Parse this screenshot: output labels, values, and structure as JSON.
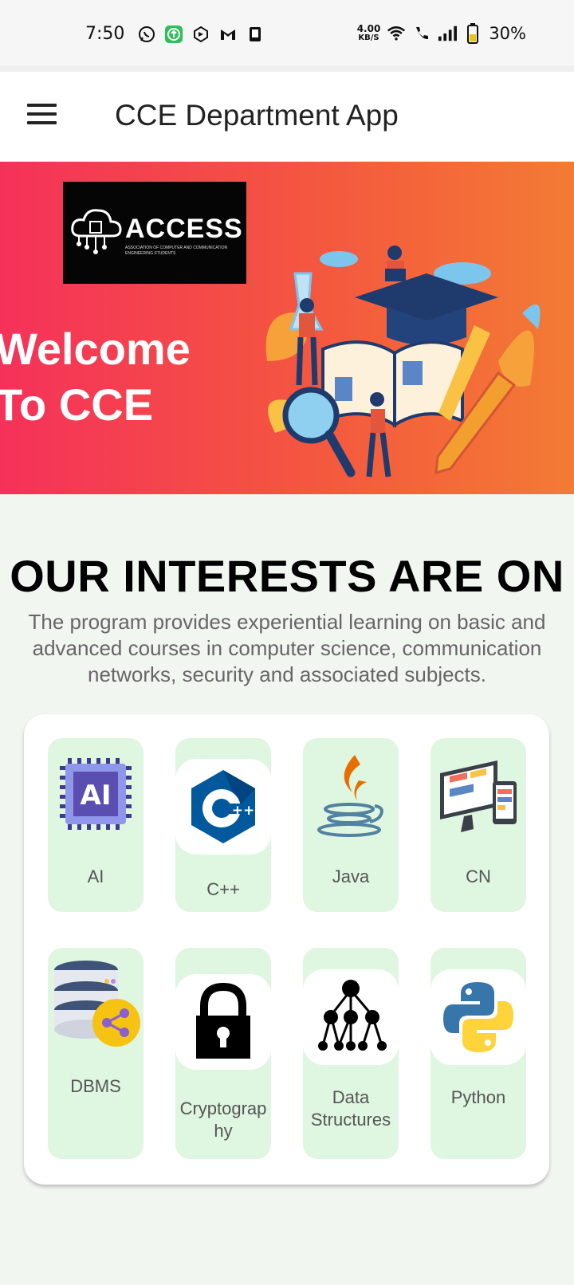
{
  "status_bar": {
    "time": "7:50",
    "net_speed_value": "4.00",
    "net_speed_unit": "KB/S",
    "battery": "30%"
  },
  "app_bar": {
    "title": "CCE Department App"
  },
  "banner": {
    "logo_text": "ACCESS",
    "logo_subtext": "ASSOCIATION OF COMPUTER AND COMMUNICATION ENGINEERING STUDENTS",
    "welcome_line1": "Welcome",
    "welcome_line2": "To CCE"
  },
  "interests": {
    "heading": "OUR INTERESTS ARE ON",
    "description": "The program provides experiential learning on basic and advanced courses in computer science, communication networks, security and associated subjects.",
    "items": [
      {
        "label": "AI",
        "icon": "ai-chip-icon"
      },
      {
        "label": "C++",
        "icon": "cpp-logo-icon"
      },
      {
        "label": "Java",
        "icon": "java-logo-icon"
      },
      {
        "label": "CN",
        "icon": "devices-icon"
      },
      {
        "label": "DBMS",
        "icon": "database-icon"
      },
      {
        "label": "Cryptograp hy",
        "icon": "lock-icon"
      },
      {
        "label": "Data Structures",
        "icon": "tree-icon"
      },
      {
        "label": "Python",
        "icon": "python-logo-icon"
      }
    ]
  },
  "colors": {
    "banner_start": "#f5315a",
    "banner_end": "#f37b34",
    "tile_bg": "#dff6e1",
    "page_bg": "#f2f6f1"
  }
}
